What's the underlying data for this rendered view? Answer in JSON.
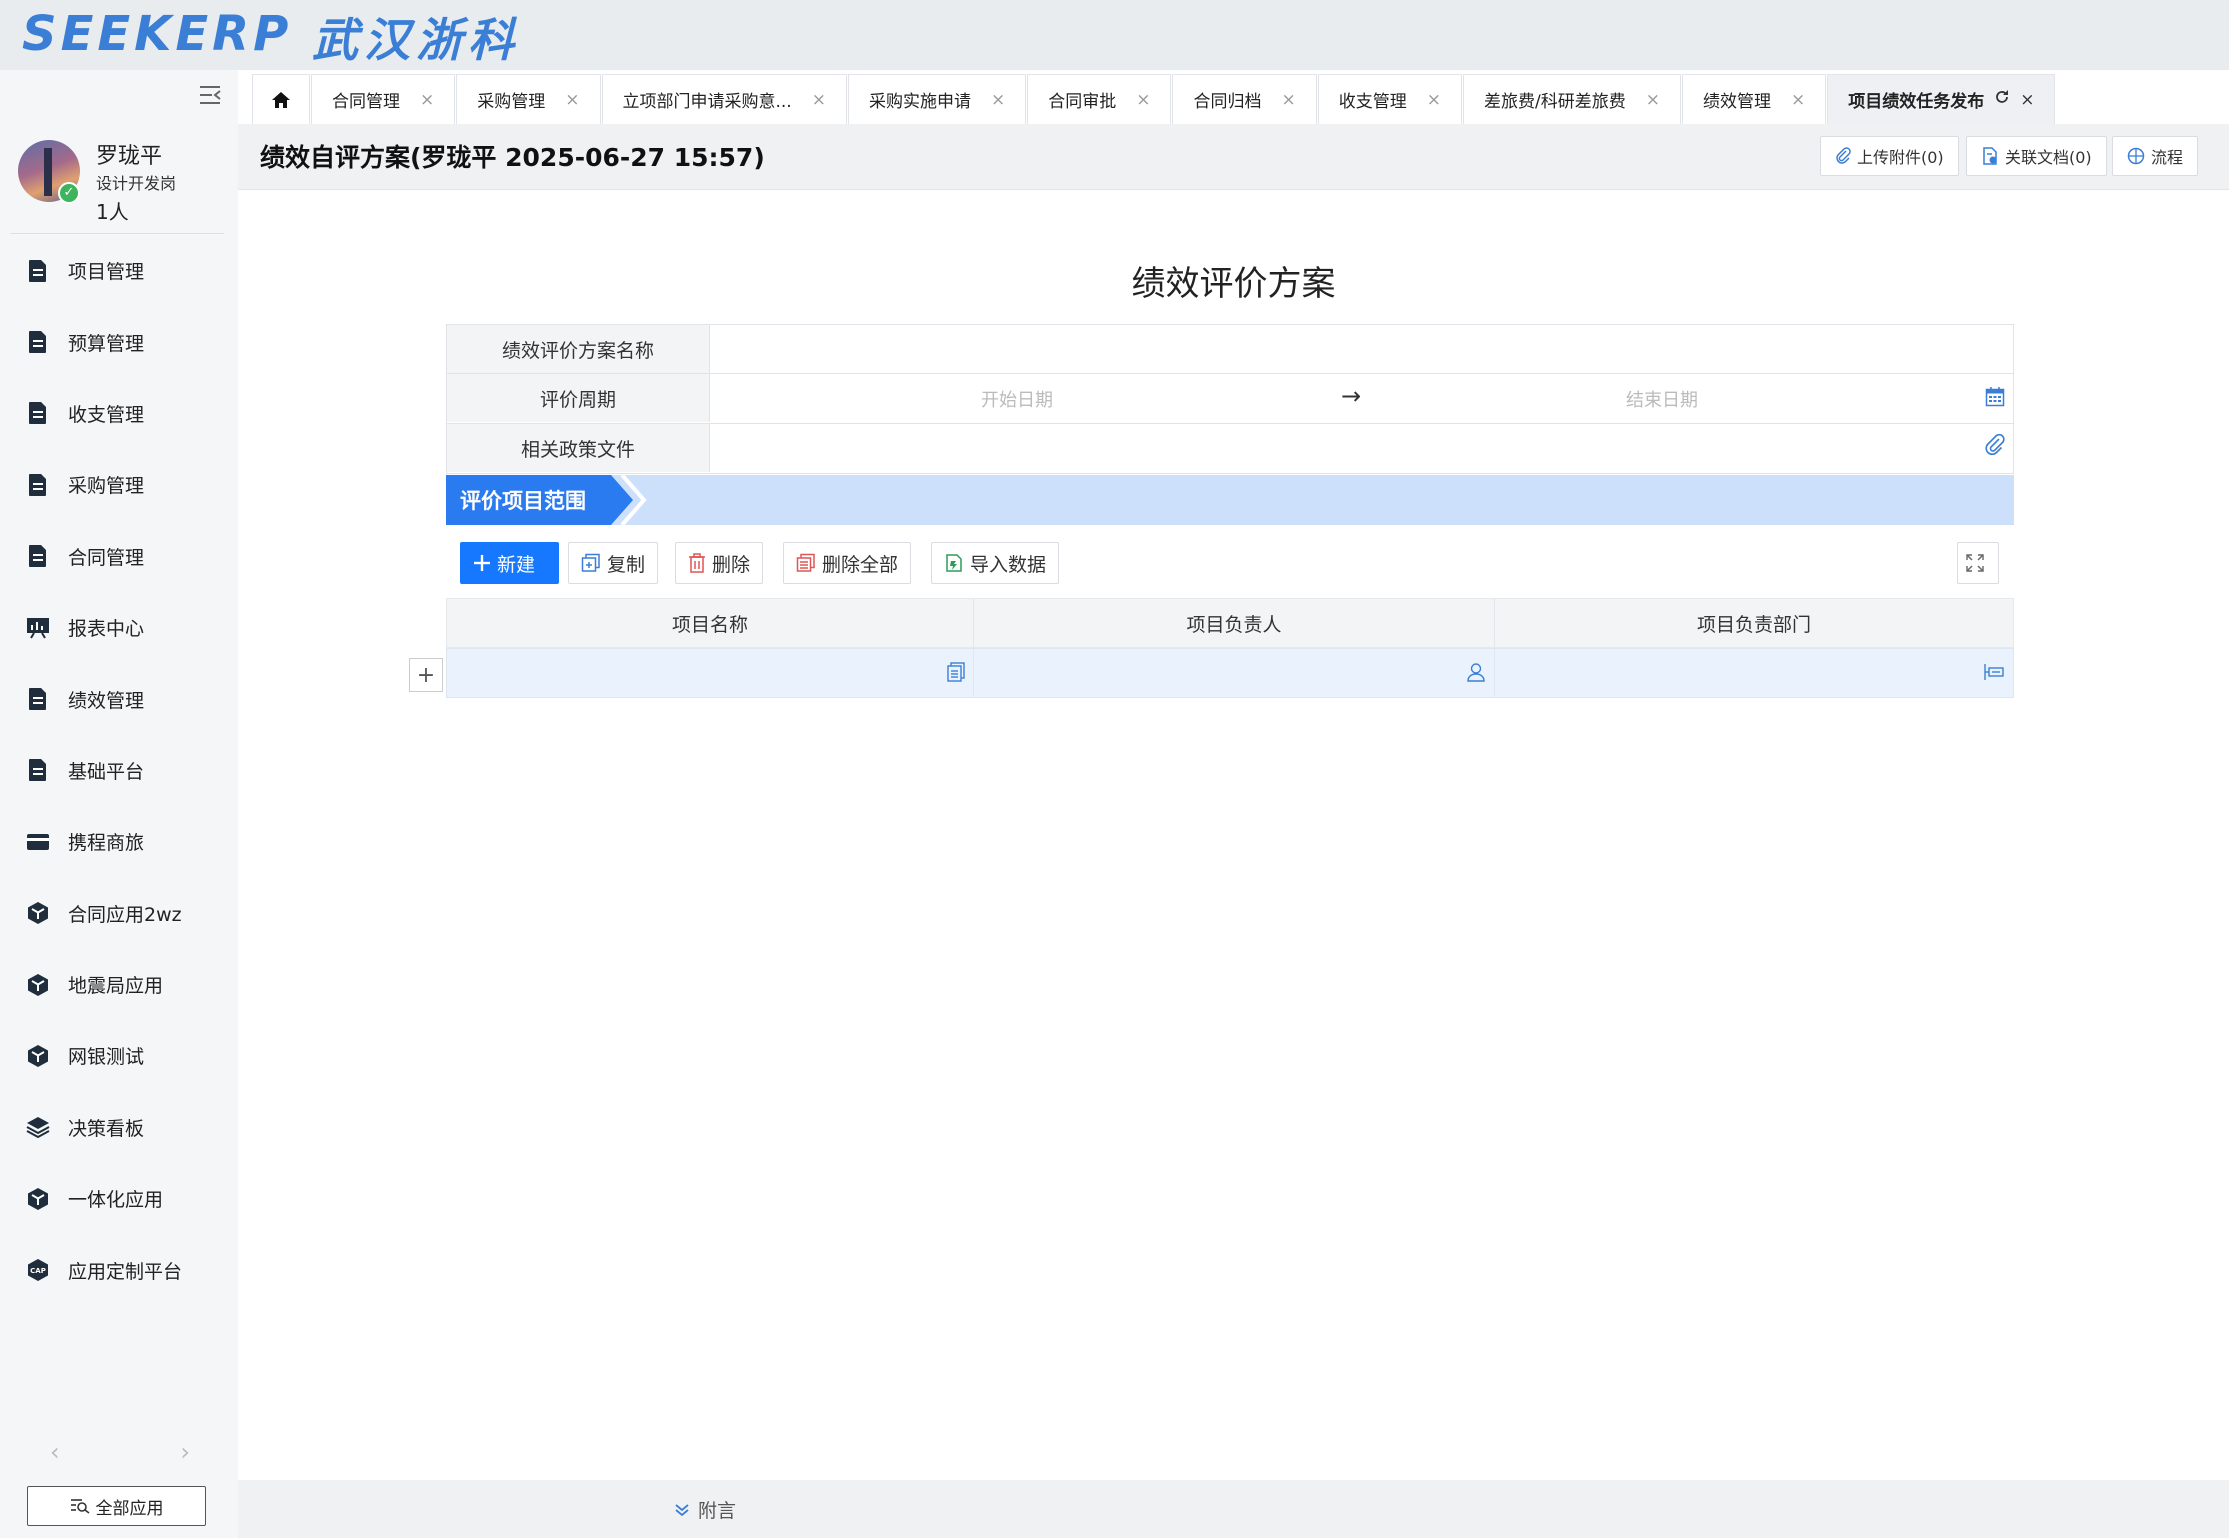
{
  "header": {
    "logo_latin": "SEEKERP",
    "logo_cn": "武汉浙科"
  },
  "user": {
    "name": "罗珑平",
    "role": "设计开发岗",
    "count": "1人"
  },
  "sidebar": {
    "items": [
      {
        "label": "项目管理",
        "icon": "document-icon"
      },
      {
        "label": "预算管理",
        "icon": "document-icon"
      },
      {
        "label": "收支管理",
        "icon": "document-icon"
      },
      {
        "label": "采购管理",
        "icon": "document-icon"
      },
      {
        "label": "合同管理",
        "icon": "document-icon"
      },
      {
        "label": "报表中心",
        "icon": "presentation-icon"
      },
      {
        "label": "绩效管理",
        "icon": "document-icon"
      },
      {
        "label": "基础平台",
        "icon": "document-icon"
      },
      {
        "label": "携程商旅",
        "icon": "wallet-icon"
      },
      {
        "label": "合同应用2wz",
        "icon": "cube-icon"
      },
      {
        "label": "地震局应用",
        "icon": "cube-icon"
      },
      {
        "label": "网银测试",
        "icon": "cube-icon"
      },
      {
        "label": "决策看板",
        "icon": "layers-icon"
      },
      {
        "label": "一体化应用",
        "icon": "cube-icon"
      },
      {
        "label": "应用定制平台",
        "icon": "cap-icon"
      }
    ],
    "all_apps_label": "全部应用"
  },
  "tabs": [
    {
      "label": "合同管理"
    },
    {
      "label": "采购管理"
    },
    {
      "label": "立项部门申请采购意..."
    },
    {
      "label": "采购实施申请"
    },
    {
      "label": "合同审批"
    },
    {
      "label": "合同归档"
    },
    {
      "label": "收支管理"
    },
    {
      "label": "差旅费/科研差旅费"
    },
    {
      "label": "绩效管理"
    },
    {
      "label": "项目绩效任务发布"
    }
  ],
  "page": {
    "title": "绩效自评方案(罗珑平 2025-06-27 15:57)",
    "upload_label": "上传附件(0)",
    "related_label": "关联文档(0)",
    "flow_label": "流程"
  },
  "form": {
    "title": "绩效评价方案",
    "fields": {
      "plan_name_label": "绩效评价方案名称",
      "period_label": "评价周期",
      "start_placeholder": "开始日期",
      "end_placeholder": "结束日期",
      "policy_label": "相关政策文件"
    },
    "section_title": "评价项目范围",
    "toolbar": {
      "new": "新建",
      "copy": "复制",
      "delete": "删除",
      "delete_all": "删除全部",
      "import": "导入数据"
    },
    "columns": [
      "项目名称",
      "项目负责人",
      "项目负责部门"
    ]
  },
  "bottom": {
    "note_label": "附言"
  },
  "colors": {
    "accent": "#1677ff",
    "section_bg": "#cde0fb",
    "row_bg": "#e9f2fd"
  }
}
